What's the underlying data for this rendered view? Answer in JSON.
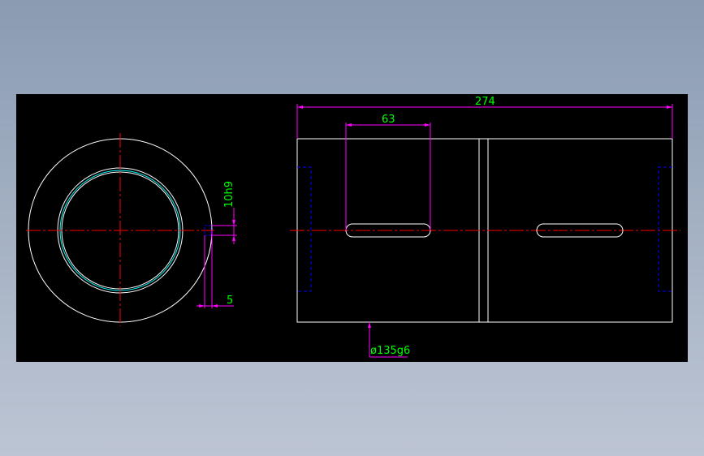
{
  "drawing": {
    "dimensions": {
      "overall_length": "274",
      "keyway_length": "63",
      "keyway_width": "10h9",
      "keyway_depth": "5",
      "outer_diameter": "ø135g6"
    },
    "colors": {
      "background": "#000000",
      "outline": "#ffffff",
      "centerline": "#ff0000",
      "dimension_line": "#ff00ff",
      "dimension_text": "#00ff00",
      "hidden_line": "#0000ff",
      "inner_ring": "#00ffff"
    }
  }
}
